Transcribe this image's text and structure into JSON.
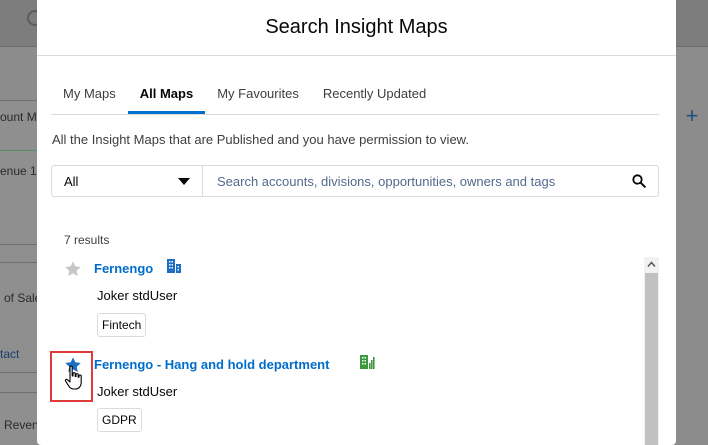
{
  "background": {
    "texts": [
      "ount M",
      "enue 1",
      "of Sale",
      "tact",
      "Reven"
    ]
  },
  "modal": {
    "title": "Search Insight Maps",
    "tabs": [
      {
        "label": "My Maps",
        "active": false
      },
      {
        "label": "All Maps",
        "active": true
      },
      {
        "label": "My Favourites",
        "active": false
      },
      {
        "label": "Recently Updated",
        "active": false
      }
    ],
    "description": "All the Insight Maps that are Published and you have permission to view.",
    "filter": {
      "selected": "All",
      "search_placeholder": "Search accounts, divisions, opportunities, owners and tags"
    },
    "results_count": "7 results",
    "results": [
      {
        "title": "Fernengo",
        "owner": "Joker stdUser",
        "tag": "Fintech",
        "favourite": false,
        "icon": "building-icon"
      },
      {
        "title": "Fernengo - Hang and hold department",
        "owner": "Joker stdUser",
        "tag": "GDPR",
        "favourite": true,
        "icon": "building-chart-icon"
      }
    ]
  },
  "colors": {
    "accent": "#0070d2",
    "link": "#006dcc",
    "star_active": "#1b6ec2",
    "star_inactive": "#c9c7c5",
    "highlight": "#e03a3a",
    "icon_blue": "#1b6ec2",
    "icon_green": "#3c9a3c"
  }
}
